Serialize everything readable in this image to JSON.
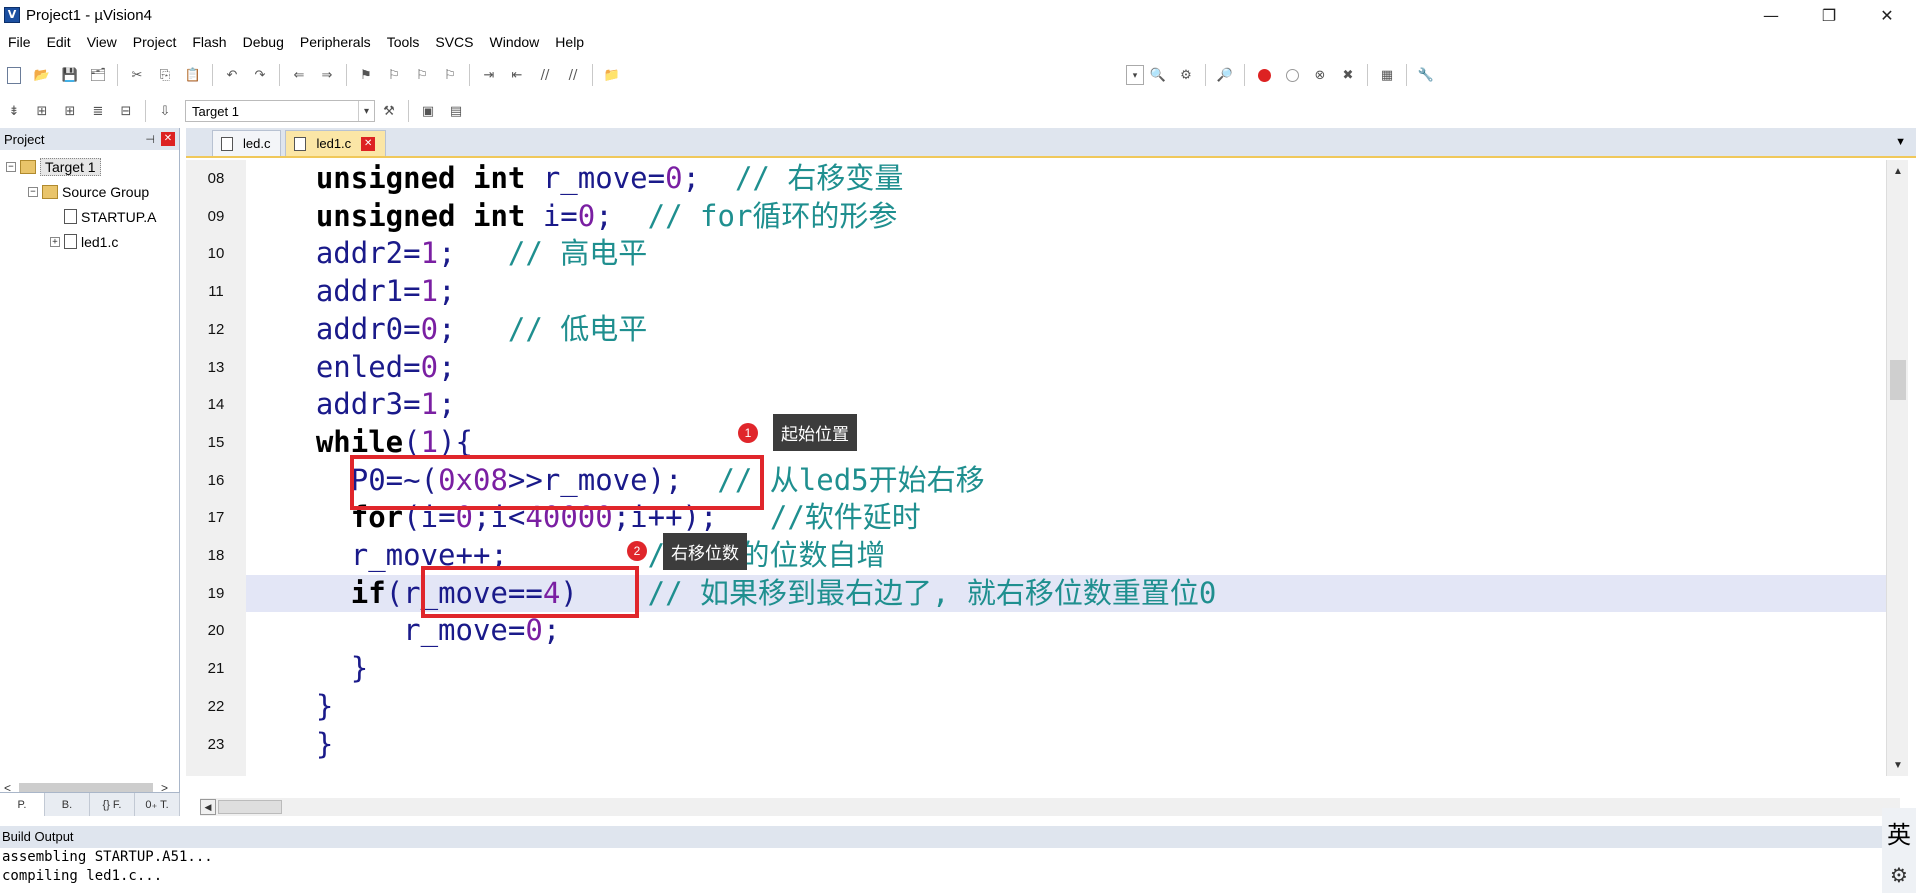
{
  "window": {
    "title": "Project1  - µVision4",
    "app_icon": "V",
    "minimize": "—",
    "restore": "❐",
    "close": "✕"
  },
  "menu": [
    "File",
    "Edit",
    "View",
    "Project",
    "Flash",
    "Debug",
    "Peripherals",
    "Tools",
    "SVCS",
    "Window",
    "Help"
  ],
  "toolbar": {
    "target_select": "Target 1",
    "target_arrow": "▾"
  },
  "project_panel": {
    "title": "Project",
    "pin": "⊣",
    "close": "✕",
    "tree": [
      {
        "label": "Target 1",
        "expander": "−",
        "level": 0
      },
      {
        "label": "Source Group",
        "expander": "−",
        "level": 1
      },
      {
        "label": "STARTUP.A",
        "expander": "",
        "level": 2
      },
      {
        "label": "led1.c",
        "expander": "+",
        "level": 2
      }
    ],
    "scroll_left": "<",
    "scroll_right": ">",
    "tabs": [
      "P.",
      "B.",
      "{} F.",
      "0₊ T."
    ]
  },
  "editor": {
    "tabs": [
      {
        "label": "led.c",
        "active": false
      },
      {
        "label": "led1.c",
        "active": true
      }
    ],
    "tab_close": "✕",
    "dropdown": "▼",
    "lines": [
      {
        "num": "08",
        "text": "    unsigned int r_move=0;  // 右移变量"
      },
      {
        "num": "09",
        "text": "    unsigned int i=0;  // for循环的形参"
      },
      {
        "num": "10",
        "text": "    addr2=1;   // 高电平"
      },
      {
        "num": "11",
        "text": "    addr1=1;"
      },
      {
        "num": "12",
        "text": "    addr0=0;   // 低电平"
      },
      {
        "num": "13",
        "text": "    enled=0;"
      },
      {
        "num": "14",
        "text": "    addr3=1;"
      },
      {
        "num": "15",
        "text": "    while(1){"
      },
      {
        "num": "16",
        "text": "      P0=~(0x08>>r_move);  // 从led5开始右移"
      },
      {
        "num": "17",
        "text": "      for(i=0;i<40000;i++);   //软件延时"
      },
      {
        "num": "18",
        "text": "      r_move++;        //右移的位数自增"
      },
      {
        "num": "19",
        "text": "      if(r_move==4)    // 如果移到最右边了, 就右移位数重置位0"
      },
      {
        "num": "20",
        "text": "         r_move=0;"
      },
      {
        "num": "21",
        "text": "      }"
      },
      {
        "num": "22",
        "text": "    }"
      },
      {
        "num": "23",
        "text": "    }"
      }
    ],
    "current_line": "19"
  },
  "annotations": [
    {
      "badge": "1",
      "tooltip": "起始位置"
    },
    {
      "badge": "2",
      "tooltip": "右移位数"
    }
  ],
  "build_output": {
    "title": "Build Output",
    "lines": [
      "assembling STARTUP.A51...",
      "compiling led1.c..."
    ]
  },
  "ime": {
    "char": "英",
    "gear": "⚙"
  },
  "colors": {
    "highlight_box": "#e0262b",
    "current_line_bg": "#e3e6f6",
    "comment": "#1f8f8f",
    "number": "#7a1fa2"
  }
}
